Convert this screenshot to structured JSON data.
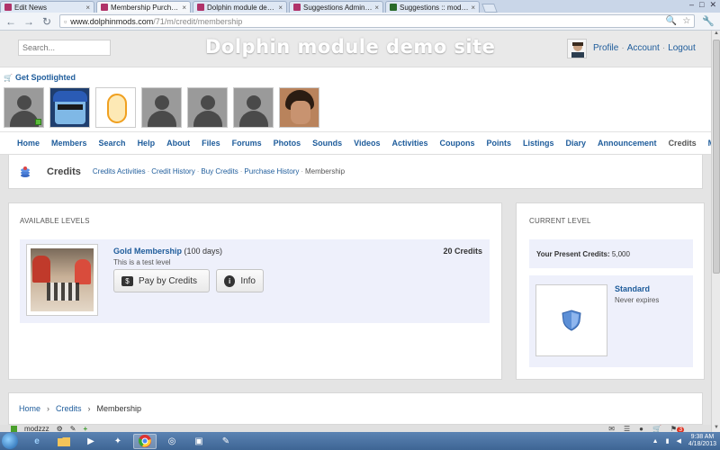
{
  "browser": {
    "tabs": [
      {
        "label": "Edit News",
        "active": false
      },
      {
        "label": "Membership Purchase",
        "active": true
      },
      {
        "label": "Dolphin module demo si...",
        "active": false
      },
      {
        "label": "Suggestions Administrati...",
        "active": false
      },
      {
        "label": "Suggestions :: modzzz's p...",
        "active": false
      }
    ],
    "url_host": "www.dolphinmods.com",
    "url_path": "/71/m/credit/membership"
  },
  "header": {
    "search_placeholder": "Search...",
    "site_title": "Dolphin module demo site",
    "user_links": [
      "Profile",
      "Account",
      "Logout"
    ]
  },
  "spotlight": {
    "title": "Get Spotlighted"
  },
  "nav": {
    "items": [
      "Home",
      "Members",
      "Search",
      "Help",
      "About",
      "Files",
      "Forums",
      "Photos",
      "Sounds",
      "Videos",
      "Activities",
      "Coupons",
      "Points",
      "Listings",
      "Diary",
      "Announcement",
      "Credits",
      "More"
    ],
    "current": "Credits"
  },
  "submenu": {
    "title": "Credits",
    "links": [
      "Credits Activities",
      "Credit History",
      "Buy Credits",
      "Purchase History"
    ],
    "current": "Membership"
  },
  "available": {
    "heading": "AVAILABLE LEVELS",
    "level": {
      "name": "Gold Membership",
      "days": "(100 days)",
      "price": "20 Credits",
      "description": "This is a test level",
      "pay_label": "Pay by Credits",
      "info_label": "Info"
    }
  },
  "current": {
    "heading": "CURRENT LEVEL",
    "credits_label": "Your Present Credits:",
    "credits_value": "5,000",
    "level_name": "Standard",
    "expiry": "Never expires"
  },
  "footer": {
    "crumbs": [
      "Home",
      "Credits"
    ],
    "current": "Membership"
  },
  "chatbar": {
    "label": "modzzz",
    "notif_count": "3"
  },
  "taskbar": {
    "time": "9:38 AM",
    "date": "4/18/2013"
  },
  "colors": {
    "link": "#1e5c9b",
    "card_bg": "#eef0fb",
    "page_bg": "#e4e4e4"
  }
}
